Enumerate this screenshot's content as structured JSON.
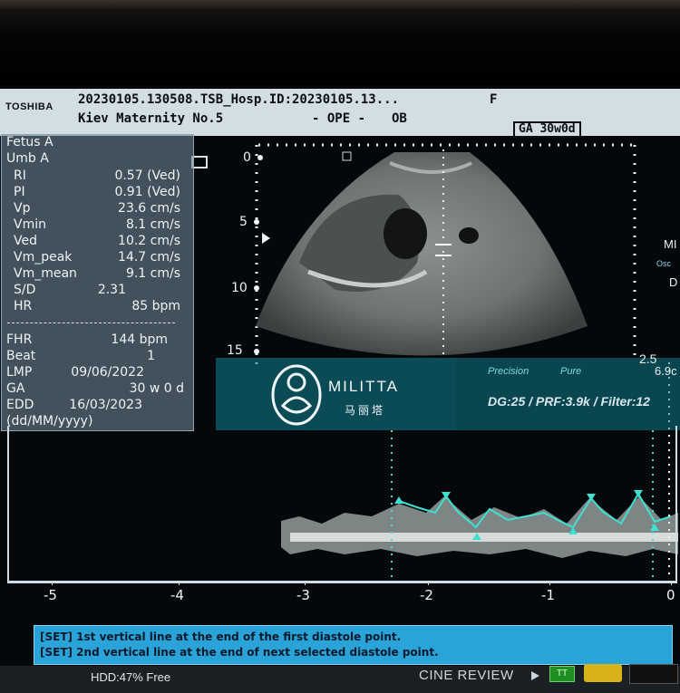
{
  "header": {
    "brand": "TOSHIBA",
    "line1": "20230105.130508.TSB_Hosp.ID:20230105.13...",
    "sex": "F",
    "line2": "Kiev   Maternity No.5",
    "mode": "- OPE -",
    "app": "OB",
    "ga_box": "GA  30w0d"
  },
  "measurements": {
    "title": "Fetus A",
    "vessel": "Umb A",
    "rows": [
      {
        "label": "RI",
        "value": "0.57 (Ved)"
      },
      {
        "label": "PI",
        "value": "0.91 (Ved)"
      },
      {
        "label": "Vp",
        "value": "23.6 cm/s"
      },
      {
        "label": "Vmin",
        "value": "8.1 cm/s"
      },
      {
        "label": "Ved",
        "value": "10.2 cm/s"
      },
      {
        "label": "Vm_peak",
        "value": "14.7 cm/s"
      },
      {
        "label": "Vm_mean",
        "value": "9.1 cm/s"
      },
      {
        "label": "S/D",
        "value": "2.31"
      },
      {
        "label": "HR",
        "value": "85 bpm"
      }
    ],
    "lower": [
      {
        "label": "FHR",
        "value": "144 bpm"
      },
      {
        "label": "Beat",
        "value": "1"
      },
      {
        "label": "LMP",
        "value": "09/06/2022"
      },
      {
        "label": "GA",
        "value": "30 w 0 d"
      },
      {
        "label": "EDD",
        "value": "16/03/2023"
      }
    ],
    "date_format": "(dd/MM/yyyy)"
  },
  "depth_scale": [
    "0",
    "5",
    "10",
    "15"
  ],
  "watermark": {
    "name": "MILITTA",
    "sub": "马丽塔"
  },
  "doppler": {
    "precision": "Precision",
    "pure": "Pure",
    "params": "DG:25 /   PRF:3.9k  / Filter:12",
    "gain": "2.5",
    "freq": "6.9c"
  },
  "side_labels": {
    "mi": "MI",
    "osc": "Osc",
    "d": "D"
  },
  "time_axis": [
    "-5",
    "-4",
    "-3",
    "-2",
    "-1",
    "0"
  ],
  "messages": [
    "[SET] 1st vertical line at the end of the first diastole point.",
    "[SET] 2nd vertical line at the end of next selected diastole point."
  ],
  "status": {
    "hdd": "HDD:47% Free",
    "cine": "CINE REVIEW",
    "green_btn": "TT"
  },
  "colors": {
    "watermark": "#0e8494",
    "message_bar": "#2aa3d9",
    "trace": "#3fe0d0"
  }
}
